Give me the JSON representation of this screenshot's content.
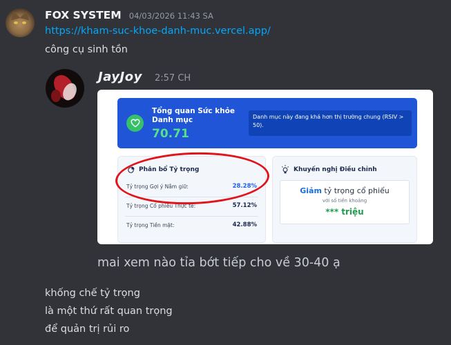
{
  "message": {
    "author": "FOX SYSTEM",
    "timestamp": "04/03/2026 11:43 SA",
    "link": "https://kham-suc-khoe-danh-muc.vercel.app/",
    "text": "công cụ sinh tồn",
    "avatar_icon": "cat-avatar"
  },
  "quoted": {
    "author": "JayJoy",
    "time": "2:57 CH",
    "avatar_icon": "robot-avatar",
    "caption": "mai xem nào tỉa bớt tiếp cho về 30-40 ạ"
  },
  "screenshot": {
    "banner": {
      "title": "Tổng quan Sức khỏe Danh mục",
      "score": "70.71",
      "note": "Danh mục này đang khá hơn thị trường chung (RSIV > 50).",
      "icon": "heart-icon"
    },
    "allocation": {
      "title": "Phân bổ Tỷ trọng",
      "icon": "pie-chart-icon",
      "rows": [
        {
          "label": "Tỷ trọng Gợi ý Nắm giữ:",
          "value": "28.28%"
        },
        {
          "label": "Tỷ trọng Cổ phiếu Thực tế:",
          "value": "57.12%"
        },
        {
          "label": "Tỷ trọng Tiền mặt:",
          "value": "42.88%"
        }
      ]
    },
    "advice": {
      "title": "Khuyến nghị Điều chỉnh",
      "icon": "lightbulb-icon",
      "action": "Giảm",
      "line1_rest": " tỷ trọng cổ phiếu",
      "line2": "với số tiền khoảng",
      "amount": "*** triệu"
    }
  },
  "followup": [
    "khống chế tỷ trọng",
    "là một thứ rất quan trọng",
    "để quản trị rủi ro"
  ],
  "colors": {
    "background": "#323339",
    "link": "#00a8fc",
    "banner": "#1f55d6",
    "score": "#57e08c",
    "annotation": "#e0141b"
  }
}
